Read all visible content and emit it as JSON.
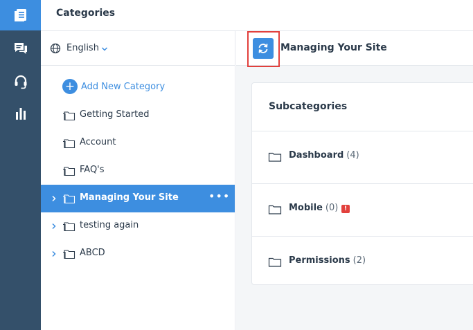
{
  "header": {
    "title": "Categories"
  },
  "rail": {
    "items": [
      {
        "icon": "document-list-icon",
        "active": true
      },
      {
        "icon": "chat-bubbles-icon",
        "active": false
      },
      {
        "icon": "headset-icon",
        "active": false
      },
      {
        "icon": "bar-chart-icon",
        "active": false
      }
    ]
  },
  "sidebar": {
    "language": "English",
    "add_label": "Add New Category",
    "categories": [
      {
        "label": "Getting Started",
        "expandable": false,
        "selected": false
      },
      {
        "label": "Account",
        "expandable": false,
        "selected": false
      },
      {
        "label": "FAQ's",
        "expandable": false,
        "selected": false
      },
      {
        "label": "Managing Your Site",
        "expandable": true,
        "selected": true,
        "more": "•••"
      },
      {
        "label": "testing again",
        "expandable": true,
        "selected": false
      },
      {
        "label": "ABCD",
        "expandable": true,
        "selected": false
      }
    ]
  },
  "main": {
    "title": "Managing Your Site",
    "card_title": "Subcategories",
    "subcategories": [
      {
        "name": "Dashboard",
        "count": "(4)",
        "warning": false
      },
      {
        "name": "Mobile",
        "count": "(0)",
        "warning": true,
        "warning_mark": "!"
      },
      {
        "name": "Permissions",
        "count": "(2)",
        "warning": false
      }
    ]
  },
  "colors": {
    "accent": "#3d8ee0",
    "rail": "#34506a",
    "warning": "#e2403c",
    "highlight": "#e2403c"
  }
}
